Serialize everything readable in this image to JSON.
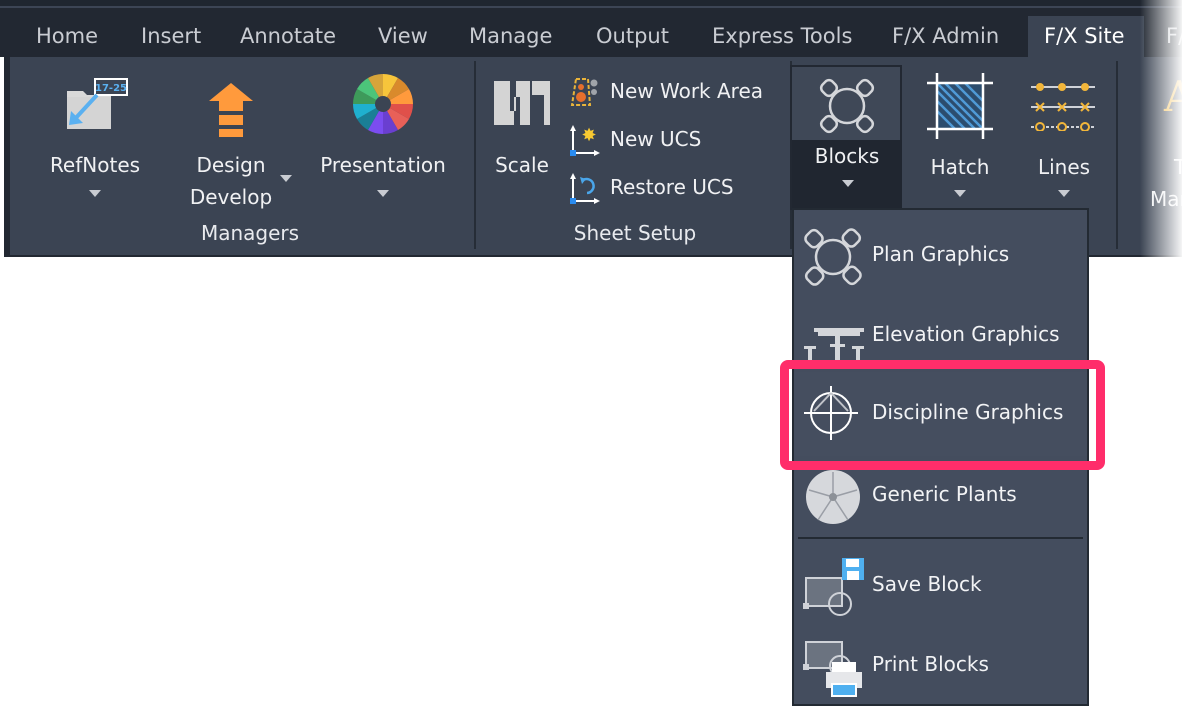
{
  "tabs": [
    {
      "label": "Home",
      "active": false
    },
    {
      "label": "Insert",
      "active": false
    },
    {
      "label": "Annotate",
      "active": false
    },
    {
      "label": "View",
      "active": false
    },
    {
      "label": "Manage",
      "active": false
    },
    {
      "label": "Output",
      "active": false
    },
    {
      "label": "Express Tools",
      "active": false
    },
    {
      "label": "F/X Admin",
      "active": false
    },
    {
      "label": "F/X Site",
      "active": true
    },
    {
      "label": "F/",
      "active": false
    }
  ],
  "panels": {
    "managers": {
      "title": "Managers",
      "buttons": [
        {
          "label": "RefNotes",
          "icon": "refnotes-folder-icon",
          "badge": "17-25",
          "has_dropdown": true
        },
        {
          "label_line1": "Design",
          "label_line2": "Develop",
          "icon": "design-develop-arrow-icon",
          "has_dropdown": true
        },
        {
          "label": "Presentation",
          "icon": "color-wheel-icon",
          "has_dropdown": true
        }
      ]
    },
    "sheet_setup": {
      "title": "Sheet Setup",
      "scale_label": "Scale",
      "small_buttons": [
        {
          "label": "New Work Area",
          "icon": "new-work-area-icon"
        },
        {
          "label": "New UCS",
          "icon": "new-ucs-icon"
        },
        {
          "label": "Restore UCS",
          "icon": "restore-ucs-icon"
        }
      ]
    },
    "graphics": {
      "buttons": [
        {
          "label": "Blocks",
          "icon": "blocks-icon",
          "has_dropdown": true,
          "pressed": true
        },
        {
          "label": "Hatch",
          "icon": "hatch-icon",
          "has_dropdown": true
        },
        {
          "label": "Lines",
          "icon": "lines-icon",
          "has_dropdown": true
        }
      ]
    },
    "text_manager": {
      "label_line1": "Te",
      "label_line2": "Mar",
      "icon": "text-icon"
    }
  },
  "blocks_menu": {
    "items": [
      {
        "label": "Plan Graphics",
        "icon": "plan-graphics-icon"
      },
      {
        "label": "Elevation Graphics",
        "icon": "elevation-graphics-icon"
      },
      {
        "label": "Discipline Graphics",
        "icon": "discipline-graphics-icon",
        "highlighted": true
      },
      {
        "label": "Generic Plants",
        "icon": "generic-plants-icon"
      },
      {
        "label": "Save Block",
        "icon": "save-block-icon"
      },
      {
        "label": "Print Blocks",
        "icon": "print-blocks-icon"
      }
    ]
  },
  "colors": {
    "tabbar_bg": "#222832",
    "ribbon_bg": "#3b4453",
    "dropdown_bg": "#444d5e",
    "highlight_border": "#ff2d6a",
    "accent_orange": "#ff9a3c",
    "accent_yellow": "#f7be3b",
    "accent_blue": "#3fa4e8"
  }
}
